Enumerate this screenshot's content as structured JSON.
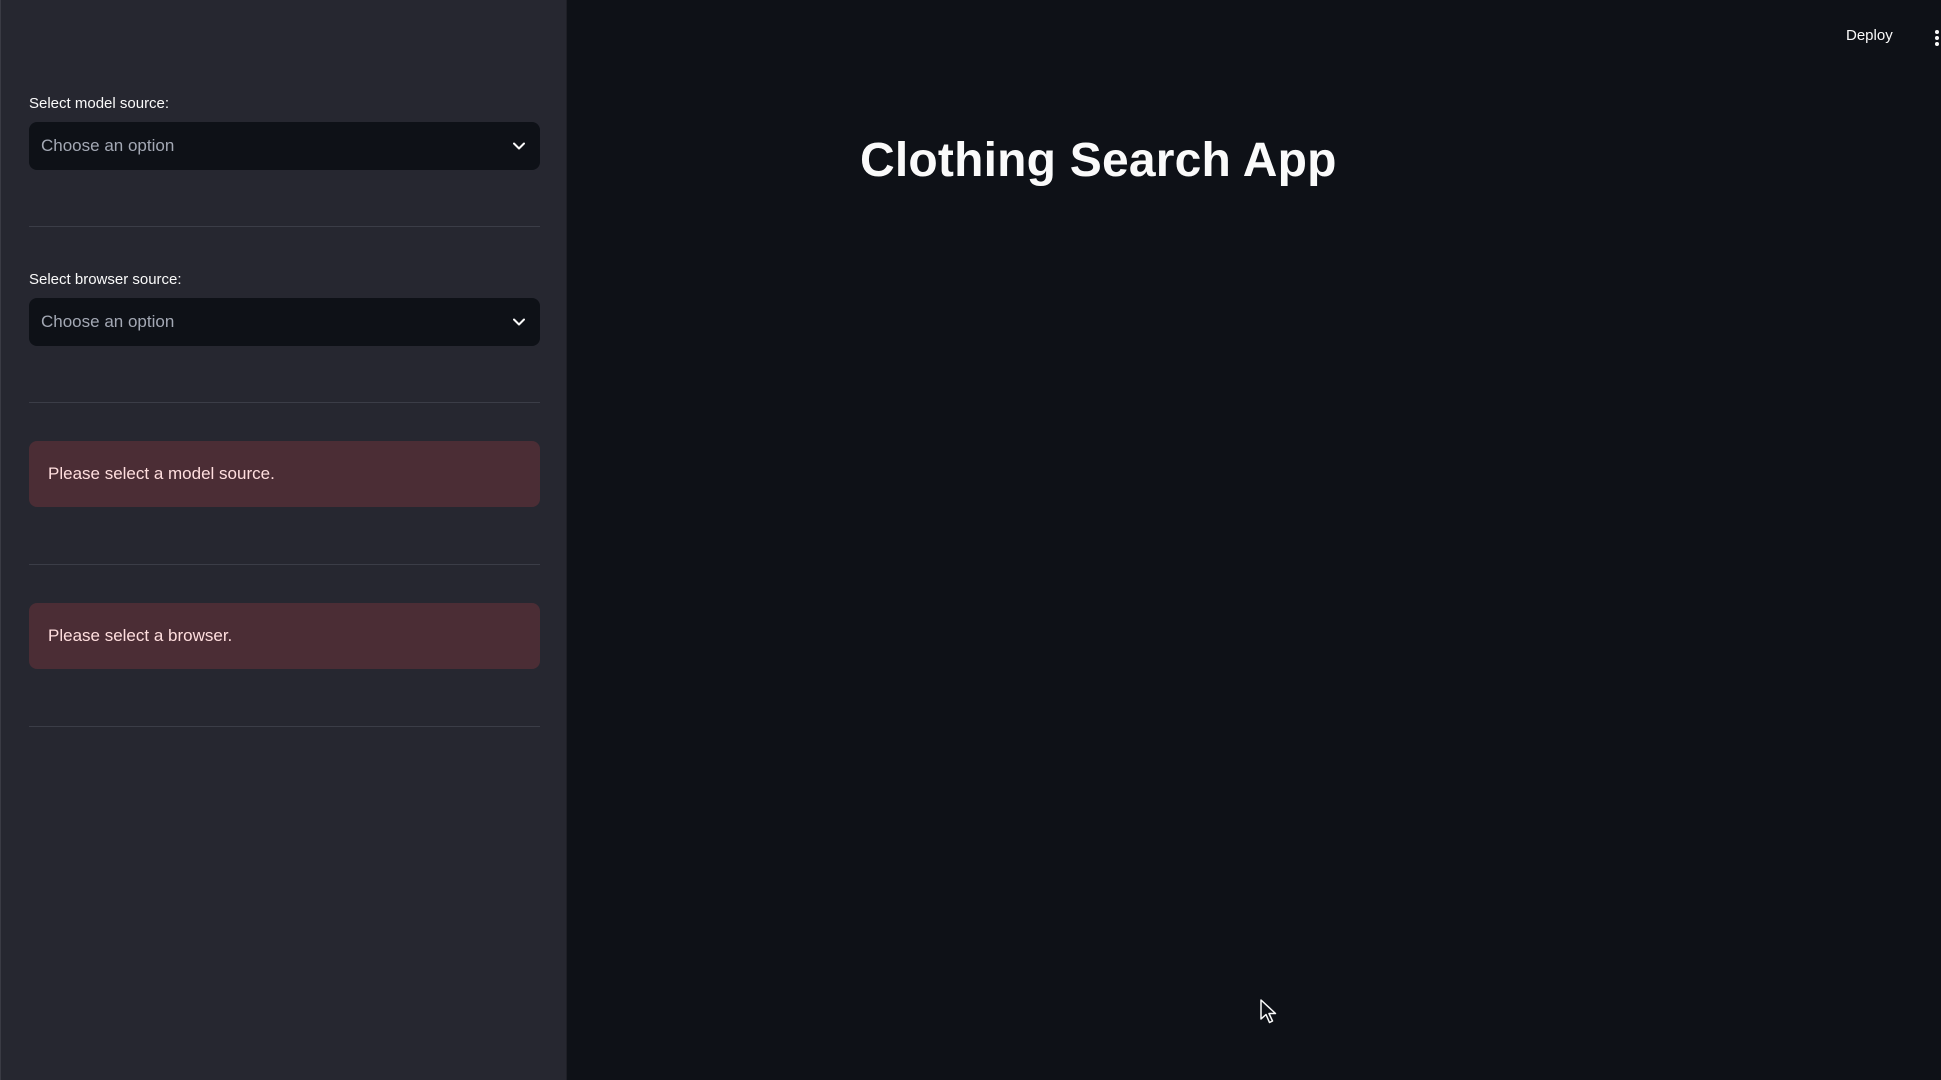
{
  "sidebar": {
    "model_select": {
      "label": "Select model source:",
      "placeholder": "Choose an option"
    },
    "browser_select": {
      "label": "Select browser source:",
      "placeholder": "Choose an option"
    },
    "alerts": [
      {
        "text": "Please select a model source."
      },
      {
        "text": "Please select a browser."
      }
    ]
  },
  "main": {
    "title": "Clothing Search App"
  },
  "header": {
    "deploy_label": "Deploy",
    "menu_icon": "kebab-menu-icon"
  },
  "colors": {
    "background": "#0e1117",
    "sidebar": "#262730",
    "alert_bg": "#4b2d35",
    "alert_text": "#ffdede"
  }
}
